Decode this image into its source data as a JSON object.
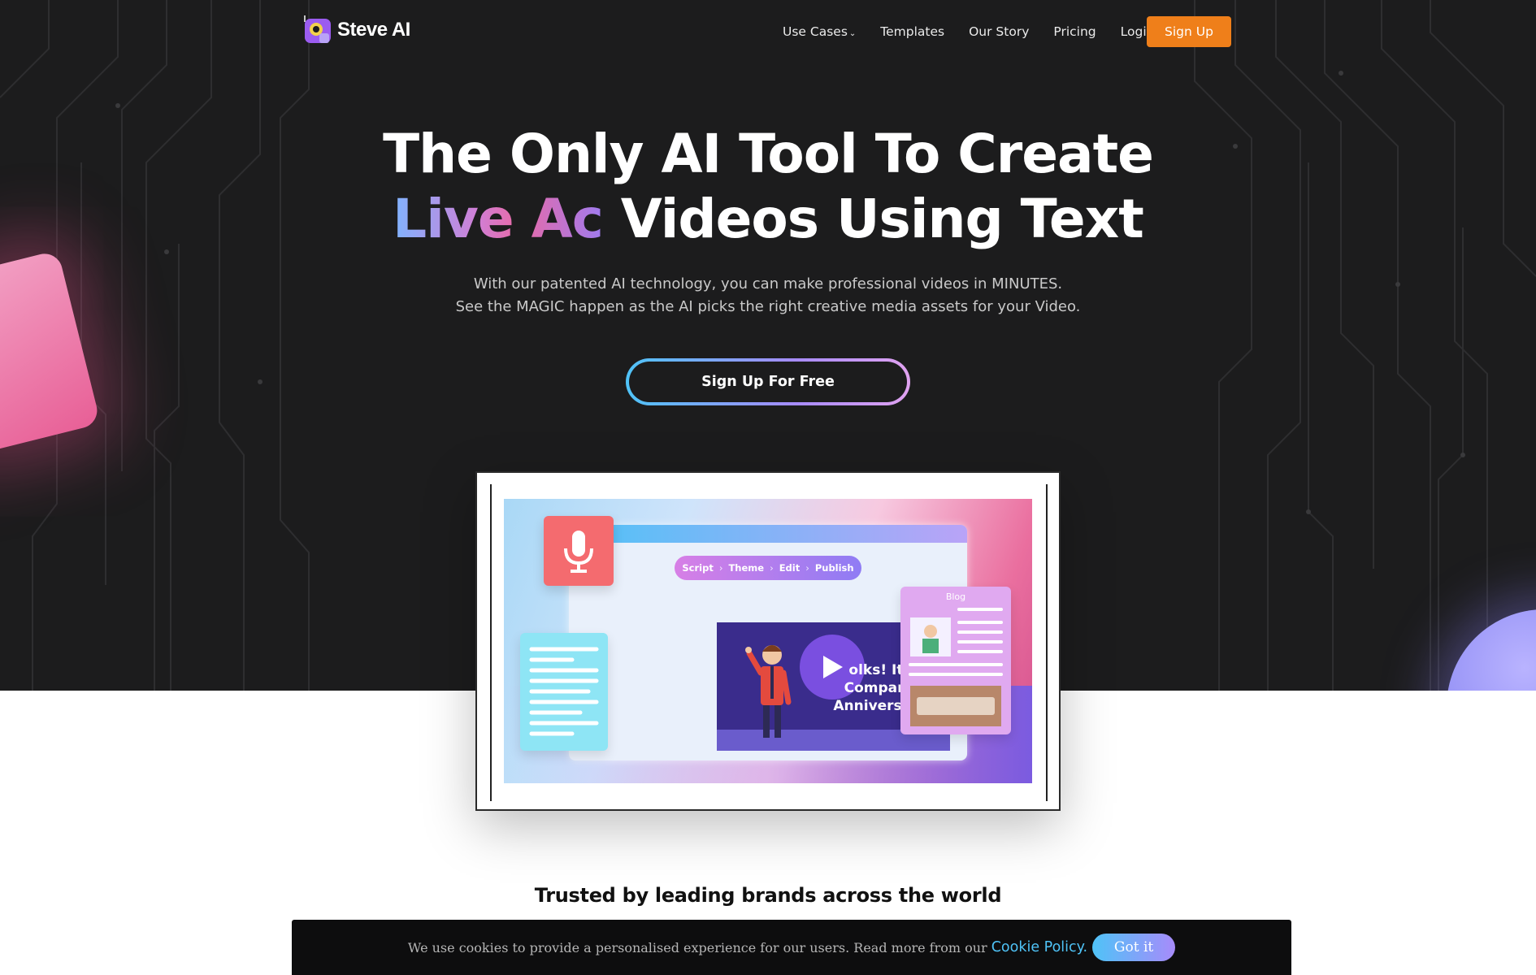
{
  "brand": {
    "name": "Steve AI"
  },
  "nav": {
    "links": [
      "Use Cases",
      "Templates",
      "Our Story",
      "Pricing",
      "Login"
    ],
    "signup_label": "Sign Up"
  },
  "hero": {
    "headline_line1": "The Only AI Tool To Create",
    "headline_gradient": "Live Ac",
    "headline_rest": " Videos Using Text",
    "sub_line1": "With our patented AI technology, you can make professional videos in MINUTES.",
    "sub_line2": "See the MAGIC happen as the AI picks the right creative media assets for your Video.",
    "cta_label": "Sign Up For Free"
  },
  "preview": {
    "steps": [
      "Script",
      "Theme",
      "Edit",
      "Publish"
    ],
    "video_text": "olks! Its\nCompany\nAnniversary",
    "blog_title": "Blog"
  },
  "trusted": {
    "title": "Trusted by leading brands across the world"
  },
  "cookie": {
    "text": "We use cookies to provide a personalised experience for our users. Read more from our",
    "link": "Cookie Policy.",
    "button": "Got it"
  },
  "colors": {
    "background": "#1c1c1d",
    "accent_orange": "#ef7f1a",
    "cyan": "#4fc3f7",
    "violet": "#a78bfa"
  }
}
